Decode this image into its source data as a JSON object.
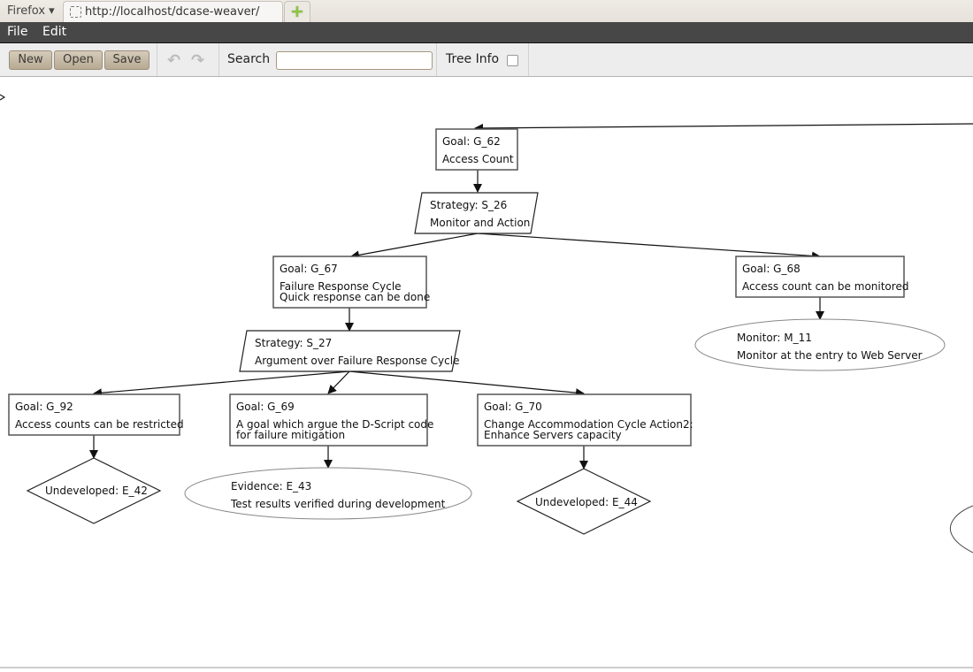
{
  "browser": {
    "menu_button": "Firefox ▾",
    "tab_title": "http://localhost/dcase-weaver/",
    "new_tab_icon": "+"
  },
  "menubar": {
    "items": [
      "File",
      "Edit"
    ]
  },
  "toolbar": {
    "new_label": "New",
    "open_label": "Open",
    "save_label": "Save",
    "undo_icon": "↶",
    "redo_icon": "↷",
    "search_label": "Search",
    "search_value": "",
    "tree_info_label": "Tree Info",
    "tree_info_checked": false
  },
  "diagram": {
    "nodes": {
      "G_62": {
        "type": "Goal",
        "title": "Goal: G_62",
        "lines": [
          "Access Count"
        ]
      },
      "S_26": {
        "type": "Strategy",
        "title": "Strategy: S_26",
        "lines": [
          "Monitor and Action"
        ]
      },
      "G_67": {
        "type": "Goal",
        "title": "Goal: G_67",
        "lines": [
          "Failure Response Cycle",
          "Quick response can be done"
        ]
      },
      "G_68": {
        "type": "Goal",
        "title": "Goal: G_68",
        "lines": [
          "Access count can be monitored"
        ]
      },
      "M_11": {
        "type": "Monitor",
        "title": "Monitor: M_11",
        "lines": [
          "Monitor at the entry to Web Server"
        ]
      },
      "S_27": {
        "type": "Strategy",
        "title": "Strategy: S_27",
        "lines": [
          "Argument over Failure Response Cycle"
        ]
      },
      "G_92": {
        "type": "Goal",
        "title": "Goal: G_92",
        "lines": [
          "Access counts can be restricted"
        ]
      },
      "G_69": {
        "type": "Goal",
        "title": "Goal: G_69",
        "lines": [
          "A goal which argue the D-Script code",
          "for failure mitigation"
        ]
      },
      "G_70": {
        "type": "Goal",
        "title": "Goal: G_70",
        "lines": [
          "Change Accommodation Cycle Action2:",
          "Enhance Servers capacity"
        ]
      },
      "E_42": {
        "type": "Undeveloped",
        "title": "Undeveloped: E_42",
        "lines": []
      },
      "E_43": {
        "type": "Evidence",
        "title": "Evidence: E_43",
        "lines": [
          "Test results verified during development"
        ]
      },
      "E_44": {
        "type": "Undeveloped",
        "title": "Undeveloped: E_44",
        "lines": []
      }
    },
    "edges": [
      [
        "offscreen-right",
        "G_62"
      ],
      [
        "G_62",
        "S_26"
      ],
      [
        "S_26",
        "G_67"
      ],
      [
        "S_26",
        "G_68"
      ],
      [
        "G_68",
        "M_11"
      ],
      [
        "G_67",
        "S_27"
      ],
      [
        "S_27",
        "G_92"
      ],
      [
        "S_27",
        "G_69"
      ],
      [
        "S_27",
        "G_70"
      ],
      [
        "G_92",
        "E_42"
      ],
      [
        "G_69",
        "E_43"
      ],
      [
        "G_70",
        "E_44"
      ]
    ]
  }
}
